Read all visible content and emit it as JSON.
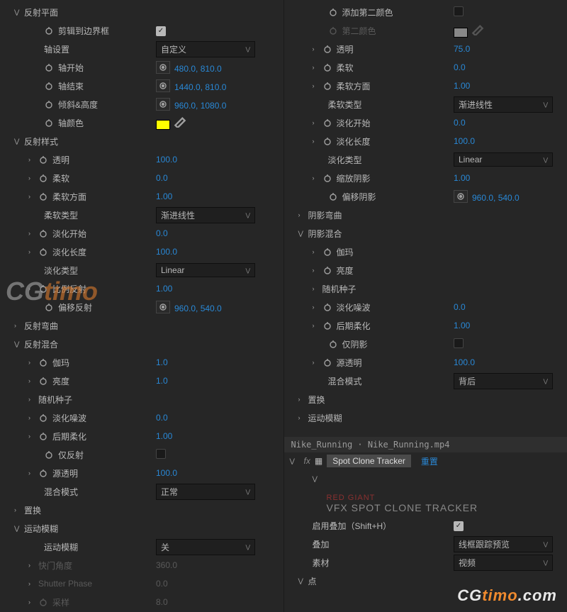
{
  "left": {
    "g1": {
      "title": "反射平面",
      "clip": "剪辑到边界框",
      "clip_on": true,
      "axis_set": "轴设置",
      "axis_set_val": "自定义",
      "axis_start": "轴开始",
      "axis_start_val": "480.0, 810.0",
      "axis_end": "轴结束",
      "axis_end_val": "1440.0, 810.0",
      "tilt": "倾斜&高度",
      "tilt_val": "960.0, 1080.0",
      "axis_color": "轴颜色"
    },
    "g2": {
      "title": "反射样式",
      "trans": "透明",
      "trans_val": "100.0",
      "soft": "柔软",
      "soft_val": "0.0",
      "soft_dir": "柔软方面",
      "soft_dir_val": "1.00",
      "soft_type": "柔软类型",
      "soft_type_val": "渐进线性",
      "fade_start": "淡化开始",
      "fade_start_val": "0.0",
      "fade_len": "淡化长度",
      "fade_len_val": "100.0",
      "fade_type": "淡化类型",
      "fade_type_val": "Linear",
      "scale": "比例反射",
      "scale_val": "1.00",
      "offset": "偏移反射",
      "offset_val": "960.0, 540.0"
    },
    "g3": {
      "title": "反射弯曲"
    },
    "g4": {
      "title": "反射混合",
      "gamma": "伽玛",
      "gamma_val": "1.0",
      "bright": "亮度",
      "bright_val": "1.0",
      "seed": "随机种子",
      "noise": "淡化噪波",
      "noise_val": "0.0",
      "post": "后期柔化",
      "post_val": "1.00",
      "only": "仅反射",
      "only_on": false,
      "src_trans": "源透明",
      "src_trans_val": "100.0",
      "blend": "混合模式",
      "blend_val": "正常"
    },
    "g5": {
      "title": "置换"
    },
    "g6": {
      "title": "运动模糊",
      "mb": "运动模糊",
      "mb_val": "关",
      "shutter": "快门角度",
      "shutter_val": "360.0",
      "phase": "Shutter Phase",
      "phase_val": "0.0",
      "samples": "采样",
      "samples_val": "8.0"
    }
  },
  "right": {
    "g1": {
      "add2": "添加第二颜色",
      "add2_on": false,
      "color2": "第二颜色",
      "trans": "透明",
      "trans_val": "75.0",
      "soft": "柔软",
      "soft_val": "0.0",
      "soft_dir": "柔软方面",
      "soft_dir_val": "1.00",
      "soft_type": "柔软类型",
      "soft_type_val": "渐进线性",
      "fade_start": "淡化开始",
      "fade_start_val": "0.0",
      "fade_len": "淡化长度",
      "fade_len_val": "100.0",
      "fade_type": "淡化类型",
      "fade_type_val": "Linear",
      "shrink": "缩放阴影",
      "shrink_val": "1.00",
      "offset": "偏移阴影",
      "offset_val": "960.0, 540.0"
    },
    "g2": {
      "title": "阴影弯曲"
    },
    "g3": {
      "title": "阴影混合",
      "gamma": "伽玛",
      "bright": "亮度",
      "seed": "随机种子",
      "noise": "淡化噪波",
      "noise_val": "0.0",
      "post": "后期柔化",
      "post_val": "1.00",
      "only": "仅阴影",
      "only_on": false,
      "src_trans": "源透明",
      "src_trans_val": "100.0",
      "blend": "混合模式",
      "blend_val": "背后"
    },
    "g4": {
      "title": "置换"
    },
    "g5": {
      "title": "运动模糊"
    },
    "footer": {
      "path": "Nike_Running · Nike_Running.mp4",
      "fx": "Spot Clone Tracker",
      "reset": "重置",
      "brand1": "RED GIANT",
      "brand2": "VFX SPOT CLONE TRACKER",
      "enable": "启用叠加（Shift+H）",
      "enable_on": true,
      "overlay": "叠加",
      "overlay_val": "线框跟踪预览",
      "mat": "素材",
      "mat_val": "视频",
      "pt": "点"
    }
  }
}
